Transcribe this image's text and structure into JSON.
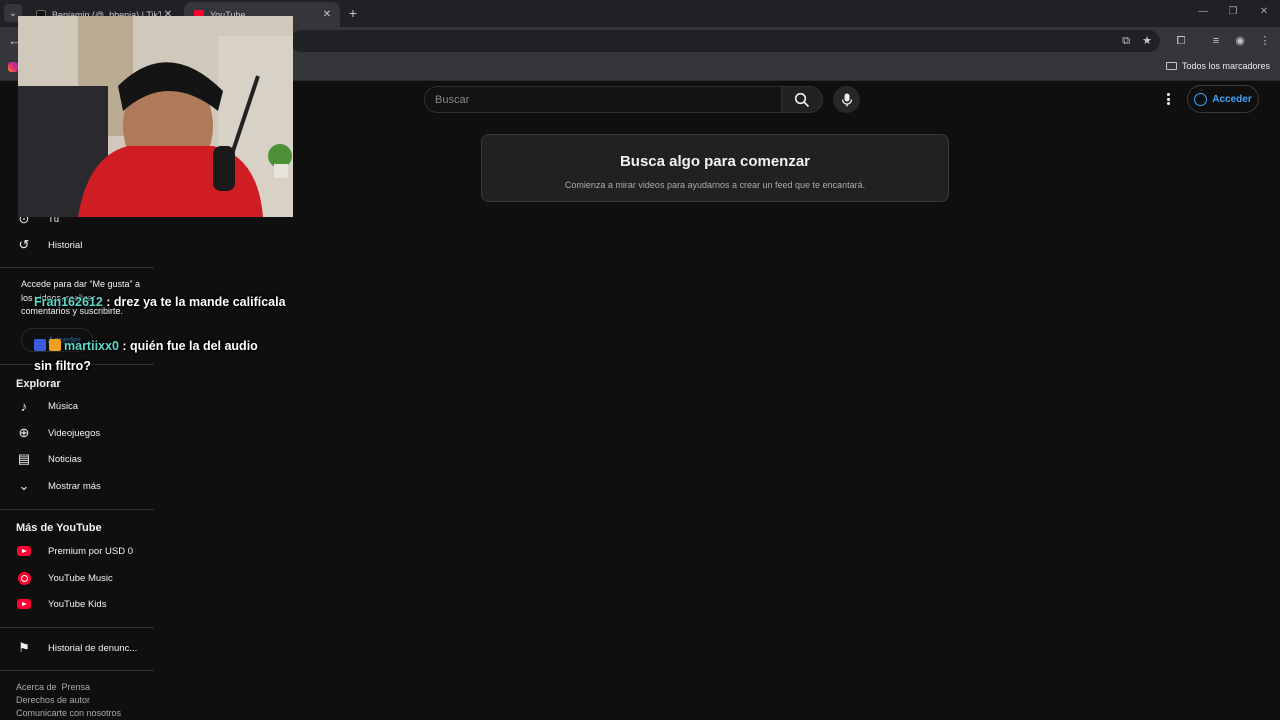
{
  "browser": {
    "tabs": [
      {
        "label": "Benjamin (@_bbenja) | TikTok"
      },
      {
        "label": "YouTube"
      }
    ],
    "new_tab": "+",
    "bookmarks_all": "Todos los marcadores"
  },
  "youtube": {
    "search": {
      "placeholder": "Buscar"
    },
    "signin_label": "Acceder",
    "empty_feed": {
      "title": "Busca algo para comenzar",
      "subtitle": "Comienza a mirar videos para ayudarnos a crear un feed que te encantará."
    }
  },
  "sidebar": {
    "you_label": "Tú",
    "history_label": "Historial",
    "signin_note": "Accede para dar “Me gusta” a los videos, realizar comentarios y suscribirte.",
    "signin_label": "Acceder",
    "explore": {
      "title": "Explorar",
      "items": [
        {
          "label": "Música",
          "icon": "music-note-icon"
        },
        {
          "label": "Videojuegos",
          "icon": "gamepad-icon"
        },
        {
          "label": "Noticias",
          "icon": "newspaper-icon"
        },
        {
          "label": "Mostrar más",
          "icon": "chevron-down-icon"
        }
      ]
    },
    "more": {
      "title": "Más de YouTube",
      "items": [
        {
          "label": "Premium por USD 0"
        },
        {
          "label": "YouTube Music"
        },
        {
          "label": "YouTube Kids"
        }
      ]
    },
    "report_history": "Historial de denunc...",
    "footer": {
      "line1_a": "Acerca de",
      "line1_b": "Prensa",
      "line2": "Derechos de autor",
      "line3": "Comunicarte con nosotros"
    }
  },
  "chat": [
    {
      "user": "Fran162612",
      "message": " : drez ya te la mande califícala"
    },
    {
      "user": "martiixx0",
      "message": " : quién fue la del audio sin filtro?"
    }
  ],
  "colors": {
    "page_bg": "#0f0f0f",
    "accent_blue": "#3ea6ff",
    "youtube_red": "#ff0033",
    "chat_user": "#5fd7c8"
  }
}
